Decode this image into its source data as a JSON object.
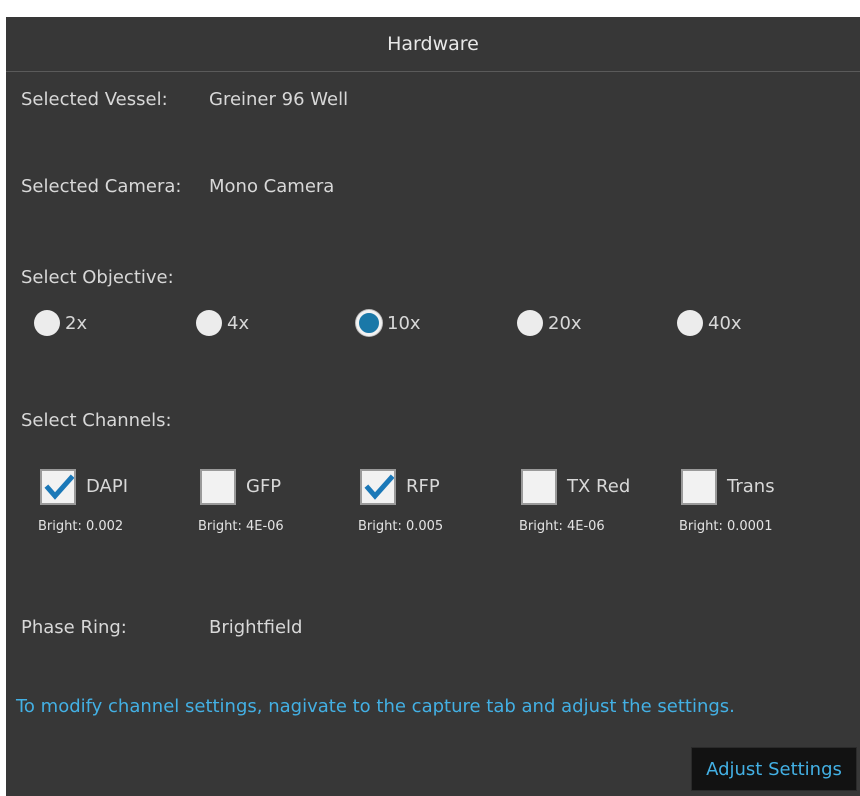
{
  "header": {
    "title": "Hardware"
  },
  "vessel": {
    "label": "Selected Vessel:",
    "value": "Greiner 96 Well"
  },
  "camera": {
    "label": "Selected Camera:",
    "value": "Mono Camera"
  },
  "objective": {
    "label": "Select Objective:",
    "options": [
      "2x",
      "4x",
      "10x",
      "20x",
      "40x"
    ],
    "selected": "10x"
  },
  "channels": {
    "label": "Select Channels:",
    "items": [
      {
        "name": "DAPI",
        "checked": true,
        "bright": "Bright: 0.002"
      },
      {
        "name": "GFP",
        "checked": false,
        "bright": "Bright: 4E-06"
      },
      {
        "name": "RFP",
        "checked": true,
        "bright": "Bright: 0.005"
      },
      {
        "name": "TX Red",
        "checked": false,
        "bright": "Bright: 4E-06"
      },
      {
        "name": "Trans",
        "checked": false,
        "bright": "Bright: 0.0001"
      }
    ]
  },
  "phase_ring": {
    "label": "Phase Ring:",
    "value": "Brightfield"
  },
  "info_text": "To modify channel settings, nagivate to the capture tab and adjust the settings.",
  "adjust_button": {
    "label": "Adjust Settings"
  },
  "colors": {
    "panel_bg": "#373737",
    "accent_text": "#43b0e4",
    "radio_selected": "#1a78a8",
    "checkmark": "#1a78b8"
  }
}
